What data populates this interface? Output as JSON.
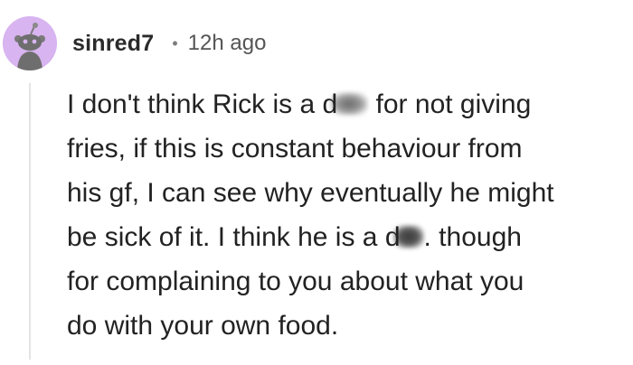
{
  "comment": {
    "username": "sinred7",
    "separator": "•",
    "timestamp": "12h ago",
    "avatar_icon": "snoo-avatar-icon",
    "avatar_bg": "#d8b4f0",
    "text_lines": [
      {
        "before": "I don't think Rick is a ",
        "censored_letter": "d",
        "after": " for not giving"
      },
      {
        "text": "fries, if this is constant behaviour from"
      },
      {
        "text": "his gf, I can see why eventually he might"
      },
      {
        "before": "be sick of it. I think he is a ",
        "censored_letter": "d",
        "after": ". though"
      },
      {
        "text": "for complaining to you about what you"
      },
      {
        "text": "do with your own food."
      }
    ]
  }
}
